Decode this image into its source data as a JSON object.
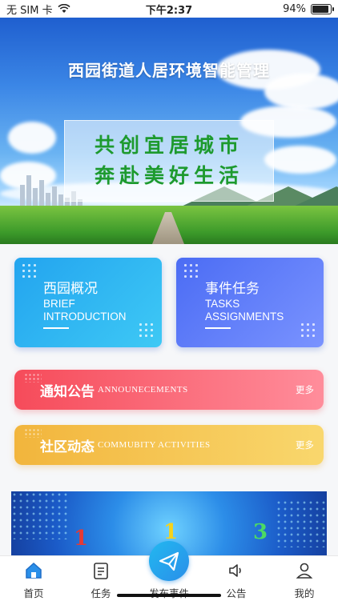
{
  "status_bar": {
    "carrier": "无 SIM 卡",
    "time": "下午2:37",
    "battery": "94%",
    "battery_level": 0.94
  },
  "banner": {
    "title": "西园街道人居环境智能管理",
    "slogan_lines": [
      "共创宜居城市",
      "奔赴美好生活"
    ]
  },
  "cards": [
    {
      "title": "西园概况",
      "en_line1": "BRIEF",
      "en_line2": "INTRODUCTION"
    },
    {
      "title": "事件任务",
      "en_line1": "TASKS",
      "en_line2": "ASSIGNMENTS"
    }
  ],
  "notices": [
    {
      "cn": "通知公告",
      "en": "ANNOUNECEMENTS",
      "more": "更多"
    },
    {
      "cn": "社区动态",
      "en": "COMMUBITY ACTIVITIES",
      "more": "更多"
    }
  ],
  "promo": {
    "numbers": [
      "1",
      "1",
      "3"
    ],
    "colors": [
      "#e53935",
      "#f5d31b",
      "#4cd964"
    ]
  },
  "tabbar": {
    "items": [
      {
        "label": "首页",
        "icon": "home-icon",
        "active": true
      },
      {
        "label": "任务",
        "icon": "clipboard-icon"
      },
      {
        "label": "发布事件",
        "icon": "paper-plane-icon"
      },
      {
        "label": "公告",
        "icon": "speaker-icon"
      },
      {
        "label": "我的",
        "icon": "user-icon"
      }
    ]
  },
  "colors": {
    "accent_blue": "#2a8fe9",
    "red_bar": "#f64b5a",
    "yellow_bar": "#f2b53c"
  }
}
